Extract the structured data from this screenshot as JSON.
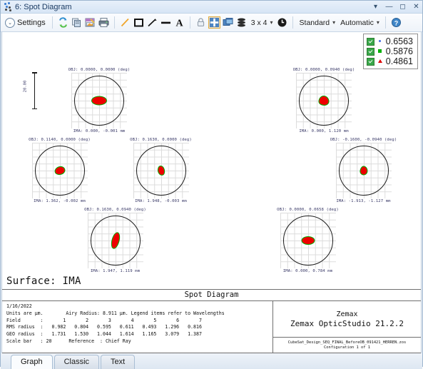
{
  "window": {
    "title": "6: Spot Diagram",
    "icon": "spot-diagram-icon",
    "buttons": {
      "dropdown": "▾",
      "minimize": "—",
      "maximize": "◻",
      "close": "✕"
    }
  },
  "toolbar": {
    "settings_label": "Settings",
    "settings_chevron": "⌄",
    "icons": [
      {
        "name": "refresh-icon",
        "title": "Refresh"
      },
      {
        "name": "copy-icon",
        "title": "Copy"
      },
      {
        "name": "save-image-icon",
        "title": "Save Image"
      },
      {
        "name": "print-icon",
        "title": "Print"
      },
      {
        "name": "line-color-icon",
        "title": "Line Color"
      },
      {
        "name": "box-icon",
        "title": "Box"
      },
      {
        "name": "diagonal-line-icon",
        "title": "Line"
      },
      {
        "name": "thick-line-icon",
        "title": "Thick Line"
      },
      {
        "name": "text-annotation-icon",
        "title": "Text"
      },
      {
        "name": "lock-icon",
        "title": "Lock"
      },
      {
        "name": "grid-layout-icon",
        "title": "Grid Layout"
      },
      {
        "name": "window-clone-icon",
        "title": "Clone Window"
      },
      {
        "name": "stack-layers-icon",
        "title": "Layers"
      }
    ],
    "grid_label": "3 x 4",
    "clock_icon": "clock-icon",
    "style_label": "Standard",
    "mode_label": "Automatic",
    "help_icon": "help-icon",
    "caret": "▾"
  },
  "legend": {
    "items": [
      {
        "checked": true,
        "marker": "dot",
        "marker_color": "#4169e1",
        "value": "0.6563"
      },
      {
        "checked": true,
        "marker": "square",
        "marker_color": "#00b000",
        "value": "0.5876"
      },
      {
        "checked": true,
        "marker": "triangle",
        "marker_color": "#dd0000",
        "value": "0.4861"
      }
    ]
  },
  "scale_bar": {
    "value": "20.00"
  },
  "spot_panels": [
    [
      {
        "obj": "OBJ: 0.0000, 0.0000 (deg)",
        "ima": "IMA: 0.000, -0.001 mm",
        "spot_w": 20,
        "spot_h": 11,
        "spot_radius": "50%",
        "spot_rotate": 0
      },
      {
        "obj": "OBJ: 0.0000, 0.0940 (deg)",
        "ima": "IMA: 0.000, 1.120 mm",
        "spot_w": 13,
        "spot_h": 12,
        "spot_radius": "48% 52% 44% 56% / 60% 58% 42% 40%",
        "spot_rotate": 0
      }
    ],
    [
      {
        "obj": "OBJ: 0.1140, 0.0000 (deg)",
        "ima": "IMA: 1.362, -0.002 mm",
        "spot_w": 13,
        "spot_h": 10,
        "spot_radius": "55% 45% 50% 50% / 55% 50% 50% 45%",
        "spot_rotate": -10
      },
      {
        "obj": "OBJ: 0.1630, 0.0000 (deg)",
        "ima": "IMA: 1.948, -0.003 mm",
        "spot_w": 8,
        "spot_h": 12,
        "spot_radius": "50% 50% 45% 55% / 52% 48% 50% 50%",
        "spot_rotate": -12
      },
      {
        "obj": "OBJ: -0.1600, -0.0940 (deg)",
        "ima": "IMA: -1.913, -1.127 mm",
        "spot_w": 9,
        "spot_h": 11,
        "spot_radius": "45% 55% 50% 50% / 60% 55% 45% 40%",
        "spot_rotate": 5
      }
    ],
    [
      {
        "obj": "OBJ: 0.1630, 0.0940 (deg)",
        "ima": "IMA: 1.947, 1.119 mm",
        "spot_w": 9,
        "spot_h": 22,
        "spot_radius": "50%",
        "spot_rotate": 15
      },
      {
        "obj": "OBJ: 0.0000, 0.0658 (deg)",
        "ima": "IMA: 0.000, 0.784 mm",
        "spot_w": 17,
        "spot_h": 10,
        "spot_radius": "50%",
        "spot_rotate": 0
      }
    ]
  ],
  "report": {
    "surface_title": "Surface: IMA",
    "header": "Spot Diagram",
    "date": "1/16/2022",
    "units_line": "Units are µm.        Airy Radius: 8.911 µm. Legend items refer to Wavelengths",
    "field_line": "Field       :       1       2       3       4       5       6       7",
    "rms_line": "RMS radius  :   0.982   0.804   0.595   0.611   0.493   1.296   0.816",
    "geo_line": "GEO radius  :   1.731   1.530   1.044   1.614   1.165   3.079   1.387",
    "scale_line": "Scale bar   : 20      Reference  : Chief Ray",
    "vendor": "Zemax",
    "product": "Zemax OpticStudio 21.2.2",
    "file_name": "CubeSat_Design_SEQ_FINAL_BeforeOB_091421_HERREN.zos",
    "configuration": "Configuration 1 of 1"
  },
  "tabs": [
    {
      "label": "Graph",
      "active": true
    },
    {
      "label": "Classic",
      "active": false
    },
    {
      "label": "Text",
      "active": false
    }
  ]
}
